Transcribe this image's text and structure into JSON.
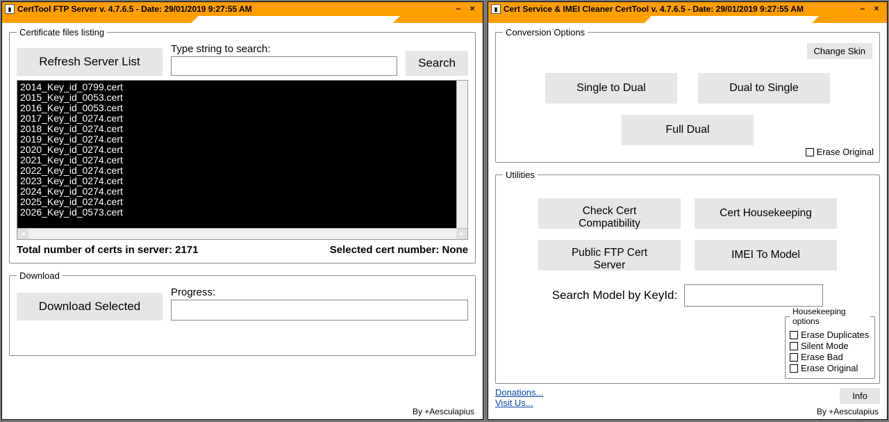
{
  "window1": {
    "title": "CertTool FTP Server v. 4.7.6.5 - Date: 29/01/2019 9:27:55 AM",
    "groups": {
      "listing": {
        "legend": "Certificate files listing",
        "refresh_label": "Refresh Server List",
        "search_label_text": "Type string to search:",
        "search_value": "",
        "search_button": "Search",
        "items": [
          "2014_Key_id_0799.cert",
          "2015_Key_id_0053.cert",
          "2016_Key_id_0053.cert",
          "2017_Key_id_0274.cert",
          "2018_Key_id_0274.cert",
          "2019_Key_id_0274.cert",
          "2020_Key_id_0274.cert",
          "2021_Key_id_0274.cert",
          "2022_Key_id_0274.cert",
          "2023_Key_id_0274.cert",
          "2024_Key_id_0274.cert",
          "2025_Key_id_0274.cert",
          "2026_Key_id_0573.cert"
        ],
        "total_label": "Total number of certs in server: 2171",
        "selected_label": "Selected cert number: None"
      },
      "download": {
        "legend": "Download",
        "download_label": "Download Selected",
        "progress_label": "Progress:"
      }
    },
    "credit": "By +Aesculapius"
  },
  "window2": {
    "title": "Cert Service & IMEI Cleaner CertTool v. 4.7.6.5 - Date: 29/01/2019 9:27:55 AM",
    "change_skin": "Change Skin",
    "groups": {
      "conversion": {
        "legend": "Conversion Options",
        "single_to_dual": "Single to Dual",
        "dual_to_single": "Dual to Single",
        "full_dual": "Full Dual",
        "erase_original": "Erase Original"
      },
      "utilities": {
        "legend": "Utilities",
        "check_cert": "Check Cert Compatibility",
        "housekeeping": "Cert Housekeeping",
        "public_ftp": "Public FTP Cert Server",
        "imei_model": "IMEI To Model",
        "search_keyid_label": "Search Model by KeyId:",
        "search_keyid_value": "",
        "hk_options": {
          "legend": "Housekeeping options",
          "erase_duplicates": "Erase Duplicates",
          "silent_mode": "Silent Mode",
          "erase_bad": "Erase Bad",
          "erase_original": "Erase Original"
        }
      }
    },
    "links": {
      "donations": "Donations...",
      "visit": "Visit Us..."
    },
    "info_button": "Info",
    "credit": "By +Aesculapius"
  }
}
